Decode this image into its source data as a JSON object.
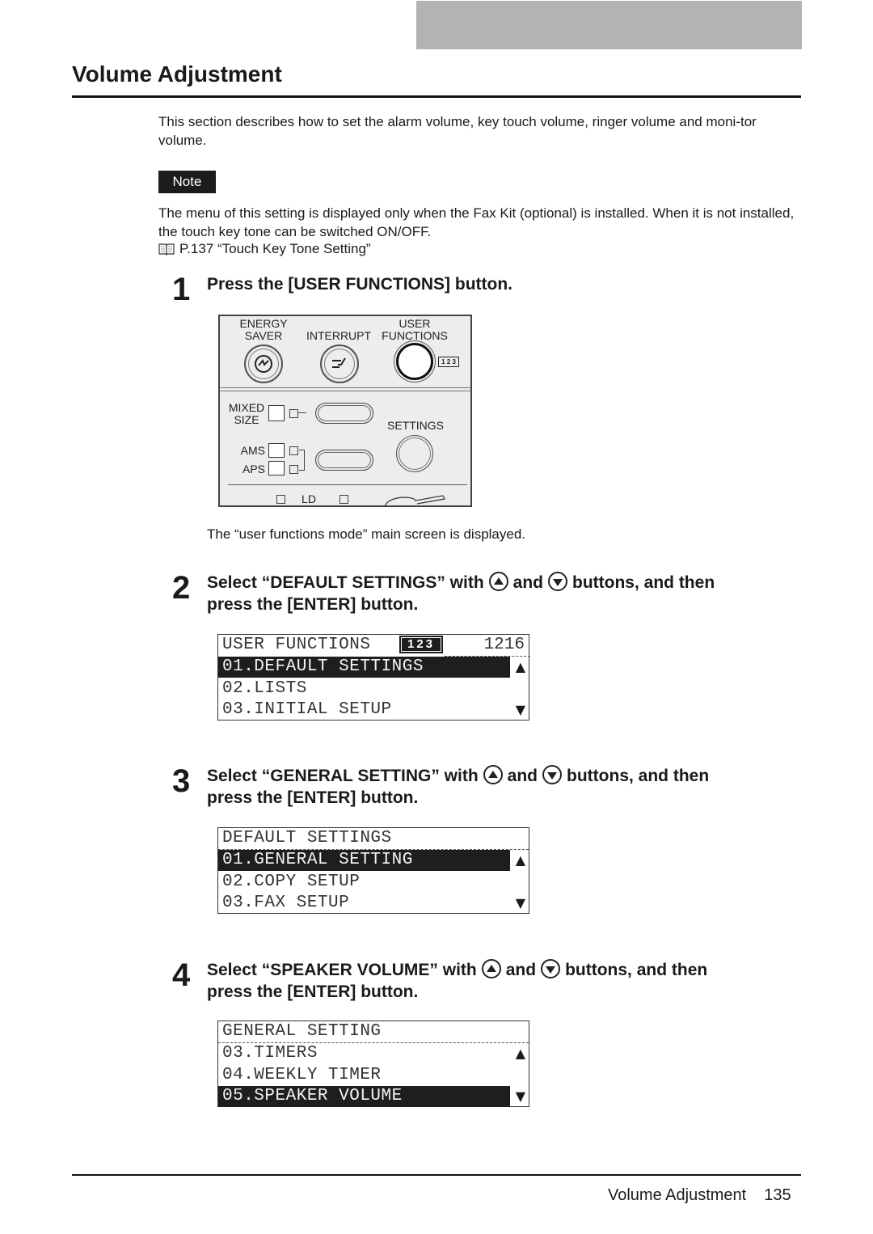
{
  "page": {
    "title": "Volume Adjustment",
    "intro": "This section describes how to set the alarm volume, key touch volume, ringer volume and moni-tor volume.",
    "note": {
      "label": "Note",
      "text": "The menu of this setting is displayed only when the Fax Kit (optional) is installed. When it is not installed, the touch key tone can be switched ON/OFF.",
      "reference_icon": "book-icon",
      "reference": "P.137 “Touch Key Tone Setting”"
    }
  },
  "steps": [
    {
      "number": "1",
      "text": "Press the [USER FUNCTIONS] button.",
      "panel": {
        "energy_saver": "ENERGY\nSAVER",
        "interrupt": "INTERRUPT",
        "user_functions": "USER\nFUNCTIONS",
        "mode_badge": "1 2 3",
        "mixed_size": "MIXED\nSIZE",
        "settings": "SETTINGS",
        "ams": "AMS",
        "aps": "APS",
        "ld": "LD"
      },
      "caption": "The “user functions mode” main screen is displayed."
    },
    {
      "number": "2",
      "text_a": "Select “DEFAULT SETTINGS” with",
      "and": "and",
      "text_b": "buttons, and then",
      "text_c": "press the [ENTER] button.",
      "lcd": {
        "header": "USER FUNCTIONS",
        "badge": "123",
        "counter": "1216",
        "rows": [
          "01.DEFAULT SETTINGS",
          "02.LISTS",
          "03.INITIAL SETUP"
        ],
        "selected_index": 0
      }
    },
    {
      "number": "3",
      "text_a": "Select “GENERAL SETTING” with",
      "and": "and",
      "text_b": "buttons, and then",
      "text_c": "press the [ENTER] button.",
      "lcd": {
        "header": "DEFAULT SETTINGS",
        "rows": [
          "01.GENERAL SETTING",
          "02.COPY SETUP",
          "03.FAX SETUP"
        ],
        "selected_index": 0
      }
    },
    {
      "number": "4",
      "text_a": "Select “SPEAKER VOLUME” with",
      "and": "and",
      "text_b": "buttons, and then",
      "text_c": "press the [ENTER] button.",
      "lcd": {
        "header": "GENERAL SETTING",
        "rows": [
          "03.TIMERS",
          "04.WEEKLY TIMER",
          "05.SPEAKER VOLUME"
        ],
        "selected_index": 2
      }
    }
  ],
  "footer": {
    "section": "Volume Adjustment",
    "page_number": "135"
  },
  "glyphs": {
    "up": "▲",
    "down": "▼"
  }
}
